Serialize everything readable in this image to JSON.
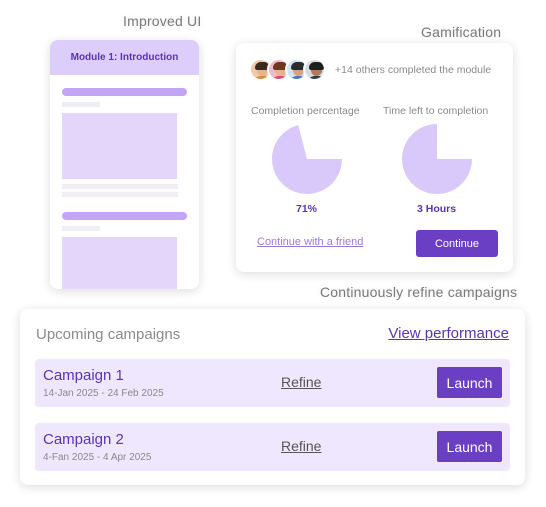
{
  "captions": {
    "improved_ui": "Improved UI",
    "gamification": "Gamification",
    "refine_campaigns": "Continuously refine campaigns"
  },
  "module": {
    "title": "Module 1: Introduction"
  },
  "gamification": {
    "others_completed": "+14 others completed the module",
    "completion_label": "Completion percentage",
    "completion_value": "71%",
    "completion_fraction": 0.71,
    "time_label": "Time left to completion",
    "time_value": "3 Hours",
    "time_fraction": 0.75,
    "friend_link": "Continue with a friend",
    "continue_label": "Continue",
    "pie_color": "#d9c9fa"
  },
  "campaigns": {
    "title": "Upcoming campaigns",
    "view_performance": "View performance",
    "items": [
      {
        "name": "Campaign 1",
        "dates": "14-Jan 2025 - 24 Feb 2025",
        "refine_label": "Refine",
        "launch_label": "Launch"
      },
      {
        "name": "Campaign 2",
        "dates": "4-Fan 2025 - 4 Apr 2025",
        "refine_label": "Refine",
        "launch_label": "Launch"
      }
    ]
  },
  "colors": {
    "accent": "#6a3fc4",
    "accent_text": "#5a35b0",
    "light_purple": "#efe7fd"
  }
}
